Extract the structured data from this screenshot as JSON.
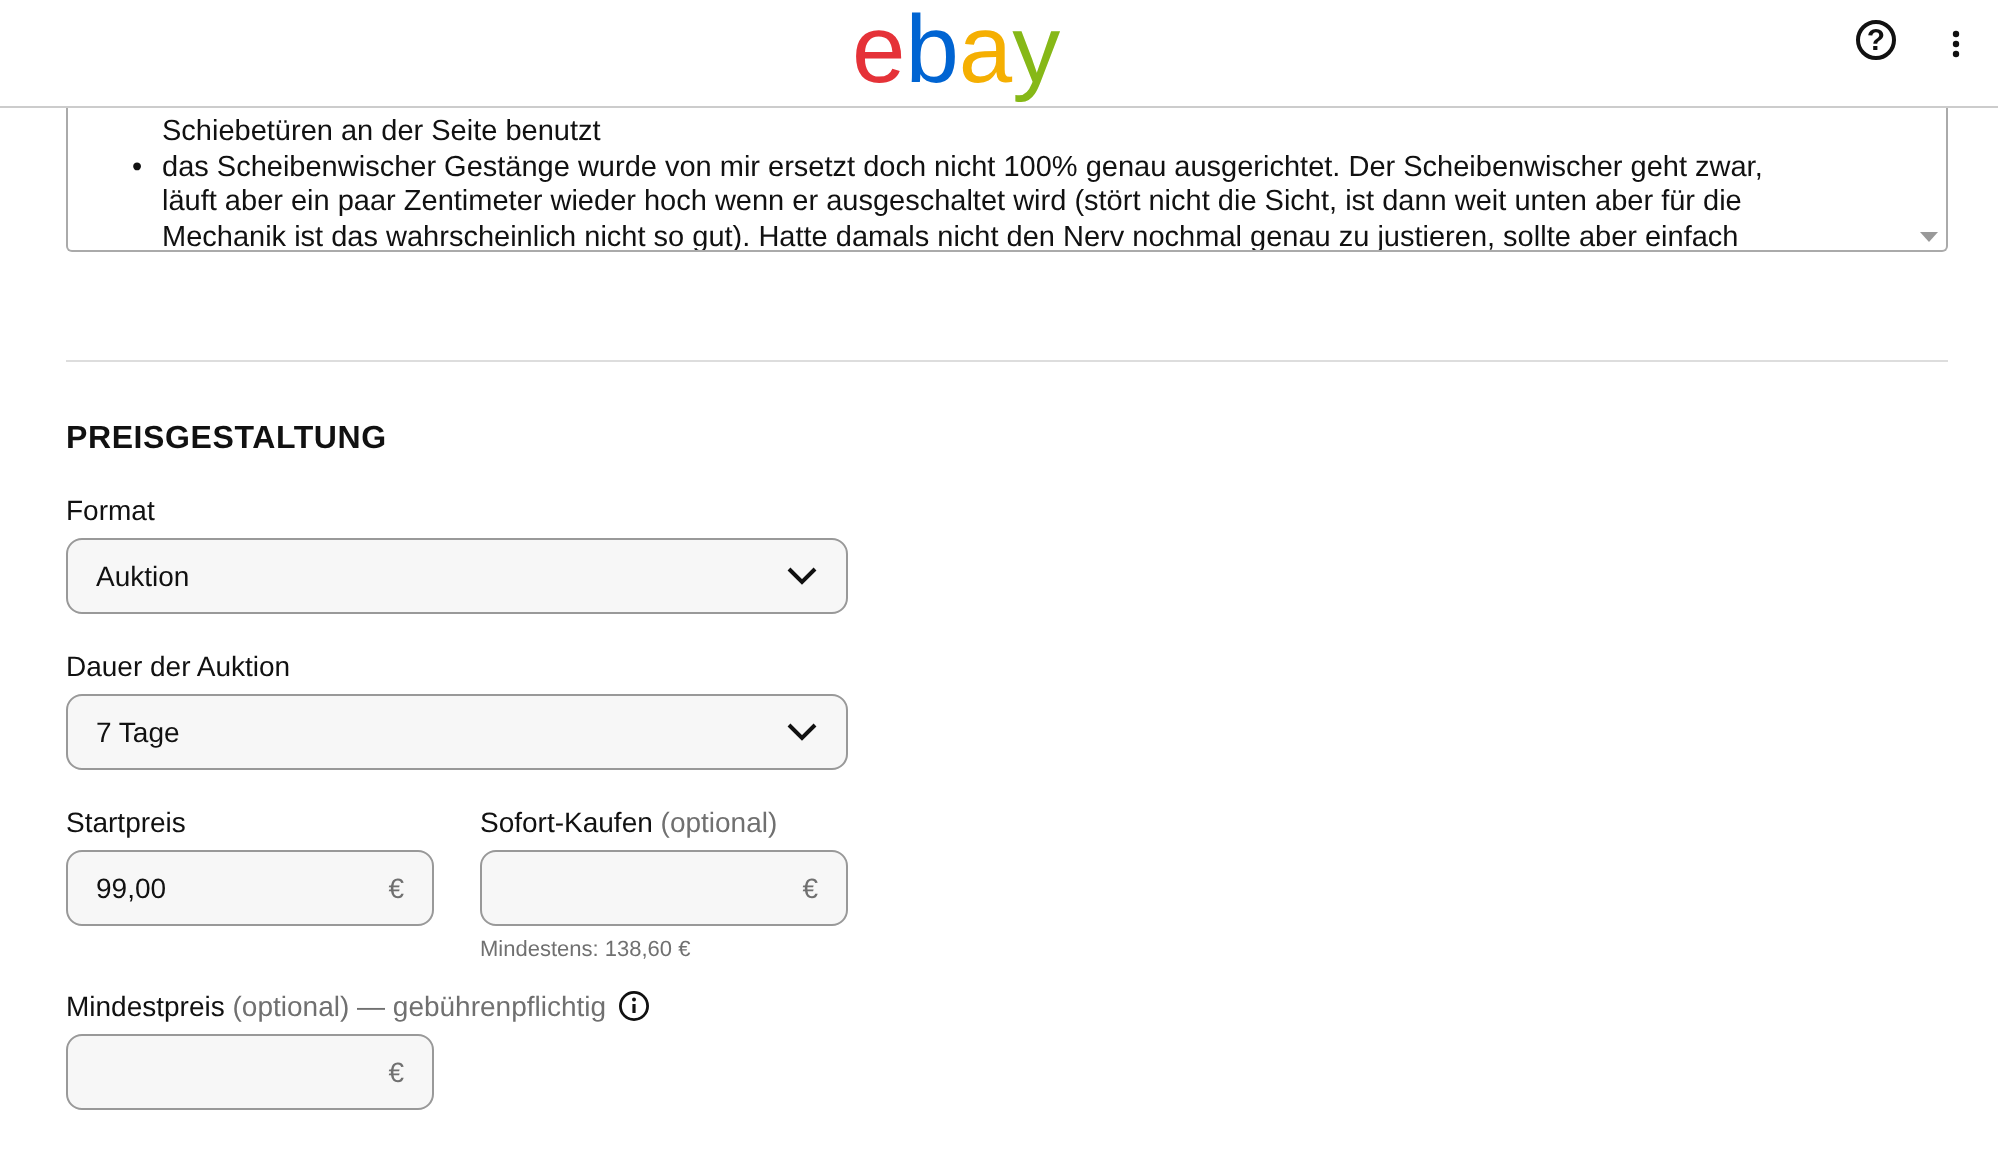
{
  "header": {
    "logo": [
      {
        "letter": "e",
        "color": "#e53238"
      },
      {
        "letter": "b",
        "color": "#0064d2"
      },
      {
        "letter": "a",
        "color": "#f5af02"
      },
      {
        "letter": "y",
        "color": "#86b817"
      }
    ],
    "help_label": "?"
  },
  "description": {
    "items": [
      {
        "kind": "continuation",
        "lines": [
          "Schiebetüren an der Seite benutzt"
        ]
      },
      {
        "kind": "bullet",
        "marker": "•",
        "lines": [
          "das Scheibenwischer Gestänge wurde von mir ersetzt doch nicht 100% genau ausgerichtet. Der Scheibenwischer geht zwar,",
          "läuft aber ein paar Zentimeter wieder hoch wenn er ausgeschaltet wird (stört nicht die Sicht, ist dann weit unten aber für die",
          "Mechanik ist das wahrscheinlich nicht so gut). Hatte damals nicht den Nerv nochmal genau zu justieren, sollte aber einfach"
        ]
      }
    ]
  },
  "pricing": {
    "title": "PREISGESTALTUNG",
    "selects": [
      {
        "label": "Format",
        "value": "Auktion"
      },
      {
        "label": "Dauer der Auktion",
        "value": "7 Tage"
      }
    ],
    "price_rows": [
      [
        {
          "label": "Startpreis",
          "value": "99,00",
          "currency": "€"
        },
        {
          "label": "Sofort-Kaufen",
          "optional": "(optional)",
          "currency": "€",
          "hint": "Mindestens: 138,60 €"
        }
      ],
      [
        {
          "label": "Mindestpreis",
          "optional": "(optional) — gebührenpflichtig",
          "currency": "€",
          "info": true
        }
      ]
    ]
  }
}
